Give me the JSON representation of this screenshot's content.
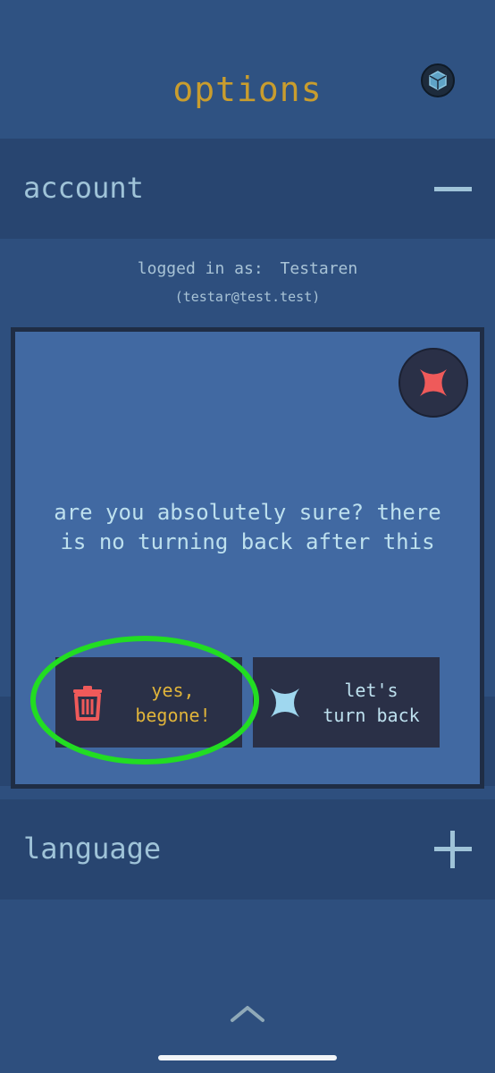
{
  "header": {
    "title": "options",
    "avatar_icon": "cube-icon"
  },
  "account": {
    "label": "account",
    "toggle_icon": "minus-icon",
    "logged_in_label": "logged in as:",
    "username": "Testaren",
    "email": "(testar@test.test)"
  },
  "dialog": {
    "close_icon": "close-icon",
    "message_line1": "are you absolutely sure? there",
    "message_line2": "is no turning back after this",
    "confirm_label": "yes,\nbegone!",
    "confirm_icon": "trash-icon",
    "cancel_label": "let's\nturn back",
    "cancel_icon": "x-icon"
  },
  "language": {
    "label": "language",
    "toggle_icon": "plus-icon"
  },
  "footer": {
    "scroll_icon": "chevron-up-icon"
  },
  "colors": {
    "background": "#2e4f7e",
    "section_bar": "#284570",
    "title": "#c99d2e",
    "dialog": "#4169a2",
    "button": "#2a3047",
    "confirm_text": "#e0b43a",
    "danger": "#ef5a5a",
    "highlight": "#22dd22"
  }
}
